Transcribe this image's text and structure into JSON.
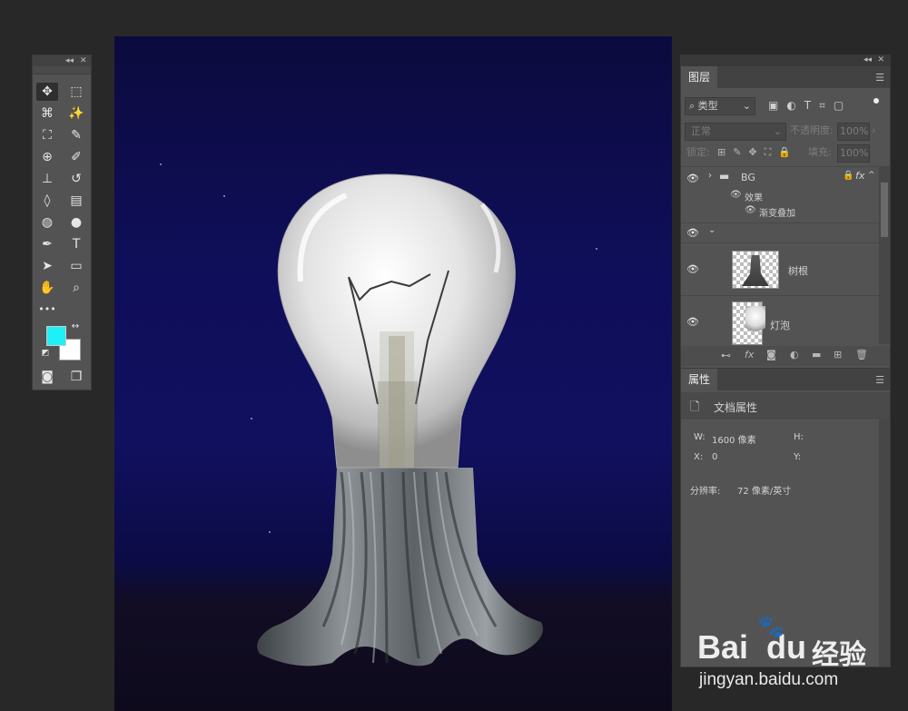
{
  "canvas": {
    "background": "#0f0e5a"
  },
  "tools": {
    "header_collapse": "◂◂",
    "header_close": "✕",
    "foreground_color": "#1ef0f8",
    "background_color": "#ffffff",
    "more_label": "•••"
  },
  "layers_panel": {
    "tab_label": "图层",
    "filter_kind": "类型",
    "blend_mode": "正常",
    "opacity_label": "不透明度:",
    "opacity_value": "100%",
    "lock_label": "锁定:",
    "fill_label": "填充:",
    "fill_value": "100%",
    "layers": [
      {
        "name": "BG",
        "type": "group",
        "has_fx": true
      },
      {
        "name": "效果",
        "type": "effects-header"
      },
      {
        "name": "渐变叠加",
        "type": "effect"
      },
      {
        "name": "",
        "type": "group-expanded"
      },
      {
        "name": "树根",
        "type": "smart-object"
      },
      {
        "name": "灯泡",
        "type": "smart-object"
      }
    ]
  },
  "properties_panel": {
    "tab_label": "属性",
    "title": "文档属性",
    "w_label": "W:",
    "w_value": "1600 像素",
    "h_label": "H:",
    "x_label": "X:",
    "x_value": "0",
    "y_label": "Y:",
    "resolution_label": "分辨率:",
    "resolution_value": "72 像素/英寸"
  },
  "watermark": {
    "brand": "Bai",
    "brand2": "du",
    "product": "经验",
    "url": "jingyan.baidu.com"
  }
}
